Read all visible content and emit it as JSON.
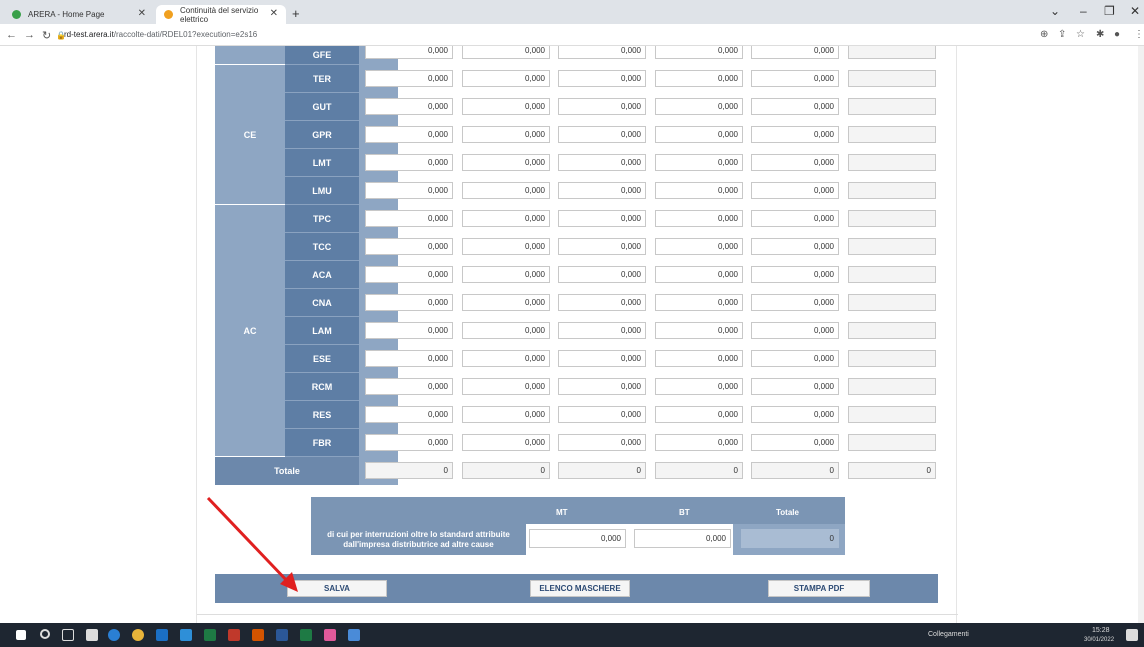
{
  "browser": {
    "tabs": [
      {
        "title": "ARERA - Home Page"
      },
      {
        "title": "Continuità del servizio elettrico"
      }
    ],
    "url_host": "rd-test.arera.it",
    "url_path": "/raccolte-dati/RDEL01?execution=e2s16"
  },
  "table": {
    "rows": [
      {
        "group": "",
        "code": "GFE",
        "values": [
          "0,000",
          "0,000",
          "0,000",
          "0,000",
          "0,000"
        ]
      },
      {
        "group": "CE",
        "code": "TER",
        "values": [
          "0,000",
          "0,000",
          "0,000",
          "0,000",
          "0,000"
        ]
      },
      {
        "group": "",
        "code": "GUT",
        "values": [
          "0,000",
          "0,000",
          "0,000",
          "0,000",
          "0,000"
        ]
      },
      {
        "group": "",
        "code": "GPR",
        "values": [
          "0,000",
          "0,000",
          "0,000",
          "0,000",
          "0,000"
        ]
      },
      {
        "group": "",
        "code": "LMT",
        "values": [
          "0,000",
          "0,000",
          "0,000",
          "0,000",
          "0,000"
        ]
      },
      {
        "group": "",
        "code": "LMU",
        "values": [
          "0,000",
          "0,000",
          "0,000",
          "0,000",
          "0,000"
        ]
      },
      {
        "group": "AC",
        "code": "TPC",
        "values": [
          "0,000",
          "0,000",
          "0,000",
          "0,000",
          "0,000"
        ]
      },
      {
        "group": "",
        "code": "TCC",
        "values": [
          "0,000",
          "0,000",
          "0,000",
          "0,000",
          "0,000"
        ]
      },
      {
        "group": "",
        "code": "ACA",
        "values": [
          "0,000",
          "0,000",
          "0,000",
          "0,000",
          "0,000"
        ]
      },
      {
        "group": "",
        "code": "CNA",
        "values": [
          "0,000",
          "0,000",
          "0,000",
          "0,000",
          "0,000"
        ]
      },
      {
        "group": "",
        "code": "LAM",
        "values": [
          "0,000",
          "0,000",
          "0,000",
          "0,000",
          "0,000"
        ]
      },
      {
        "group": "",
        "code": "ESE",
        "values": [
          "0,000",
          "0,000",
          "0,000",
          "0,000",
          "0,000"
        ]
      },
      {
        "group": "",
        "code": "RCM",
        "values": [
          "0,000",
          "0,000",
          "0,000",
          "0,000",
          "0,000"
        ]
      },
      {
        "group": "",
        "code": "RES",
        "values": [
          "0,000",
          "0,000",
          "0,000",
          "0,000",
          "0,000"
        ]
      },
      {
        "group": "",
        "code": "FBR",
        "values": [
          "0,000",
          "0,000",
          "0,000",
          "0,000",
          "0,000"
        ]
      }
    ],
    "groups": [
      {
        "label": "CE"
      },
      {
        "label": "AC"
      }
    ],
    "totale_label": "Totale",
    "totale_values": [
      "0",
      "0",
      "0",
      "0",
      "0",
      "0"
    ]
  },
  "subtable": {
    "headers": [
      "MT",
      "BT",
      "Totale"
    ],
    "label": "di cui per interruzioni oltre lo standard attribuite dall'impresa distributrice ad altre cause",
    "values": [
      "0,000",
      "0,000",
      "0"
    ]
  },
  "buttons": {
    "save": "SALVA",
    "list": "ELENCO MASCHERE",
    "pdf": "STAMPA PDF"
  },
  "taskbar": {
    "links_label": "Collegamenti",
    "time": "15:28",
    "date": "30/01/2022"
  },
  "colors": {
    "header_blue": "#5e7ea5",
    "light_blue": "#8ea6c3",
    "arrow_red": "#e02020"
  }
}
